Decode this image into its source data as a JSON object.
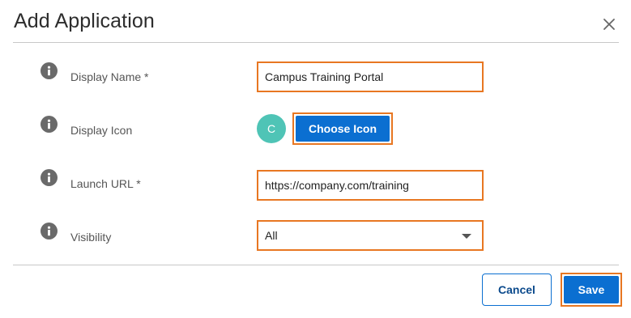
{
  "dialog": {
    "title": "Add Application",
    "close_icon": "close-icon"
  },
  "fields": {
    "display_name": {
      "label": "Display Name *",
      "value": "Campus Training Portal",
      "icon": "info-icon"
    },
    "display_icon": {
      "label": "Display Icon",
      "avatar_letter": "C",
      "choose_label": "Choose Icon",
      "icon": "info-icon"
    },
    "launch_url": {
      "label": "Launch URL *",
      "value": "https://company.com/training",
      "icon": "info-icon"
    },
    "visibility": {
      "label": "Visibility",
      "value": "All",
      "icon": "info-icon",
      "caret_icon": "caret-down-icon"
    }
  },
  "footer": {
    "cancel_label": "Cancel",
    "save_label": "Save"
  },
  "colors": {
    "primary": "#0b6fd1",
    "highlight": "#e87722",
    "avatar": "#4fc4b6",
    "info_icon": "#6a6a6a"
  }
}
